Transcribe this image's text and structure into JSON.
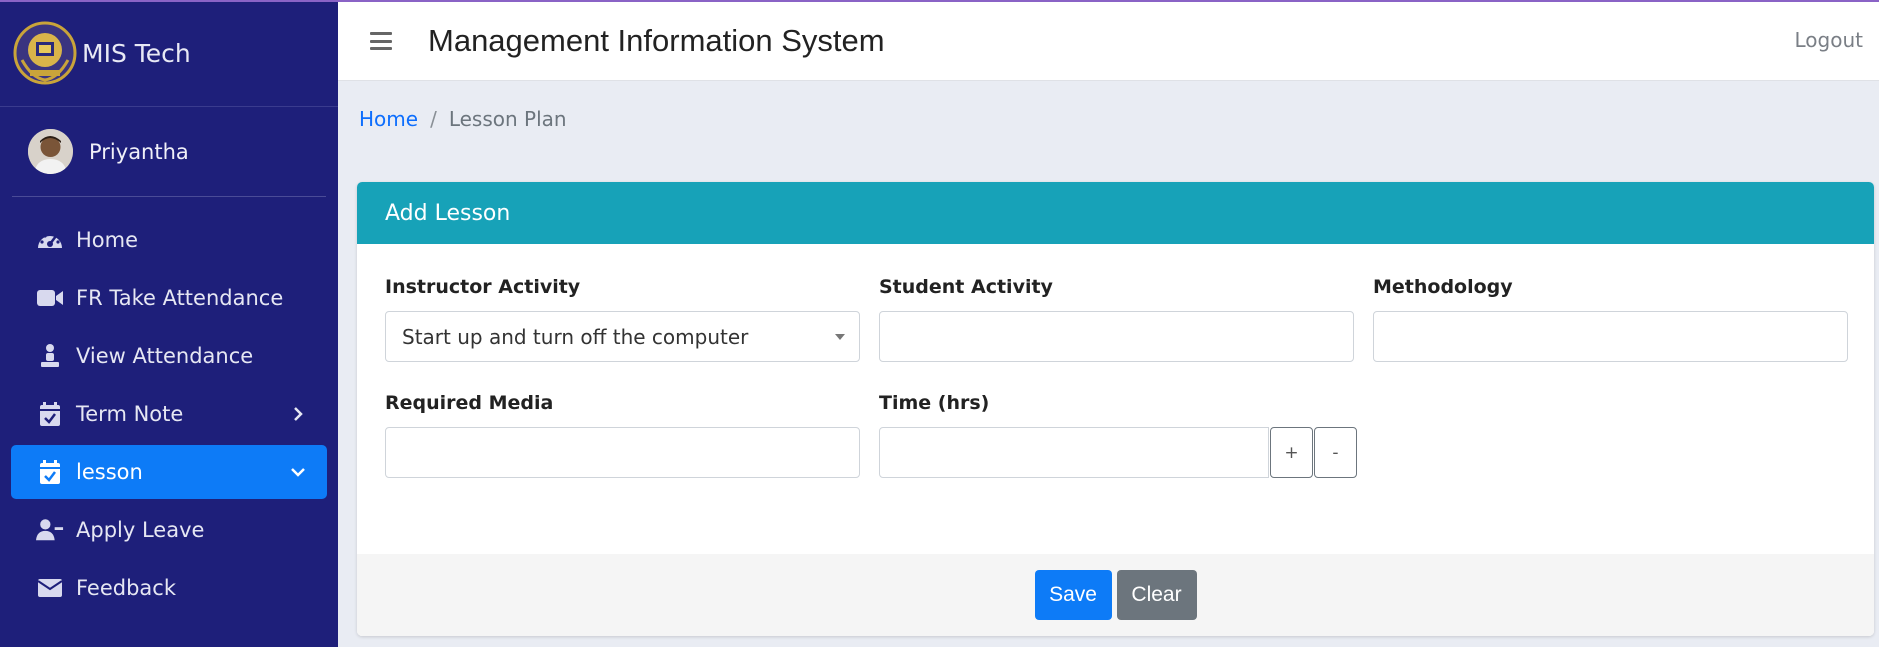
{
  "brand": {
    "name": "MIS Tech",
    "logo_icon": "emblem-icon"
  },
  "user": {
    "name": "Priyantha"
  },
  "sidebar": {
    "items": [
      {
        "label": "Home",
        "icon": "dashboard-gauge-icon"
      },
      {
        "label": "FR Take Attendance",
        "icon": "video-camera-icon"
      },
      {
        "label": "View Attendance",
        "icon": "person-podium-icon"
      },
      {
        "label": "Term Note",
        "icon": "calendar-check-icon",
        "arrow": "chevron-right-icon"
      },
      {
        "label": "lesson",
        "icon": "calendar-check-icon",
        "arrow": "chevron-down-icon",
        "active": true
      },
      {
        "label": "Apply Leave",
        "icon": "user-minus-icon"
      },
      {
        "label": "Feedback",
        "icon": "envelope-icon"
      }
    ]
  },
  "header": {
    "title": "Management Information System",
    "logout_label": "Logout"
  },
  "breadcrumb": {
    "home": "Home",
    "separator": "/",
    "current": "Lesson Plan"
  },
  "card": {
    "title": "Add Lesson",
    "fields": {
      "instructor_activity": {
        "label": "Instructor Activity",
        "value": "Start up and turn off the computer"
      },
      "student_activity": {
        "label": "Student Activity",
        "value": ""
      },
      "methodology": {
        "label": "Methodology",
        "value": ""
      },
      "required_media": {
        "label": "Required Media",
        "value": ""
      },
      "time": {
        "label": "Time (hrs)",
        "value": "",
        "plus": "+",
        "minus": "-"
      }
    },
    "buttons": {
      "save": "Save",
      "clear": "Clear"
    }
  },
  "colors": {
    "sidebar_bg": "#1e1f7a",
    "active_item": "#0d7bf7",
    "card_header": "#17a2b8",
    "save_button": "#0d7bf7",
    "clear_button": "#6c757d",
    "link": "#0d6efd"
  }
}
